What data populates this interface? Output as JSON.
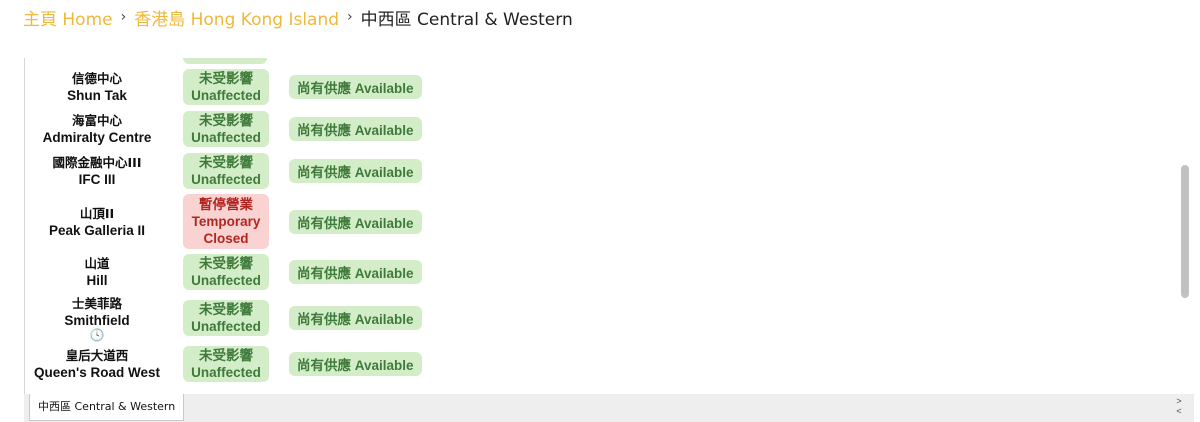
{
  "breadcrumb": {
    "home": "主頁 Home",
    "region": "香港島 Hong Kong Island",
    "current": "中西區 Central & Western",
    "separator": "›"
  },
  "rows": [
    {
      "name_zh": "信德中心",
      "name_en": "Shun Tak",
      "status_zh": "未受影響",
      "status_en": "Unaffected",
      "status_type": "ok",
      "availability": "尚有供應 Available"
    },
    {
      "name_zh": "海富中心",
      "name_en": "Admiralty Centre",
      "status_zh": "未受影響",
      "status_en": "Unaffected",
      "status_type": "ok",
      "availability": "尚有供應 Available"
    },
    {
      "name_zh": "國際金融中心III",
      "name_en": "IFC III",
      "status_zh": "未受影響",
      "status_en": "Unaffected",
      "status_type": "ok",
      "availability": "尚有供應 Available"
    },
    {
      "name_zh": "山頂II",
      "name_en": "Peak Galleria II",
      "status_zh": "暫停營業",
      "status_en": "Temporary Closed",
      "status_type": "closed",
      "availability": "尚有供應 Available"
    },
    {
      "name_zh": "山道",
      "name_en": "Hill",
      "status_zh": "未受影響",
      "status_en": "Unaffected",
      "status_type": "ok",
      "availability": "尚有供應 Available"
    },
    {
      "name_zh": "士美菲路",
      "name_en": "Smithfield",
      "status_zh": "未受影響",
      "status_en": "Unaffected",
      "status_type": "ok",
      "availability": "尚有供應 Available",
      "clock": "🕓"
    },
    {
      "name_zh": "皇后大道西",
      "name_en": "Queen's Road West",
      "status_zh": "未受影響",
      "status_en": "Unaffected",
      "status_type": "ok",
      "availability": "尚有供應 Available"
    }
  ],
  "sheet_tab": "中西區 Central & Western",
  "tab_nav": {
    "next": ">",
    "prev": "<"
  },
  "colors": {
    "link": "#f0b83a",
    "ok_bg": "#d4edc9",
    "ok_text": "#3e7a39",
    "closed_bg": "#f8d3d2",
    "closed_text": "#b32620"
  }
}
